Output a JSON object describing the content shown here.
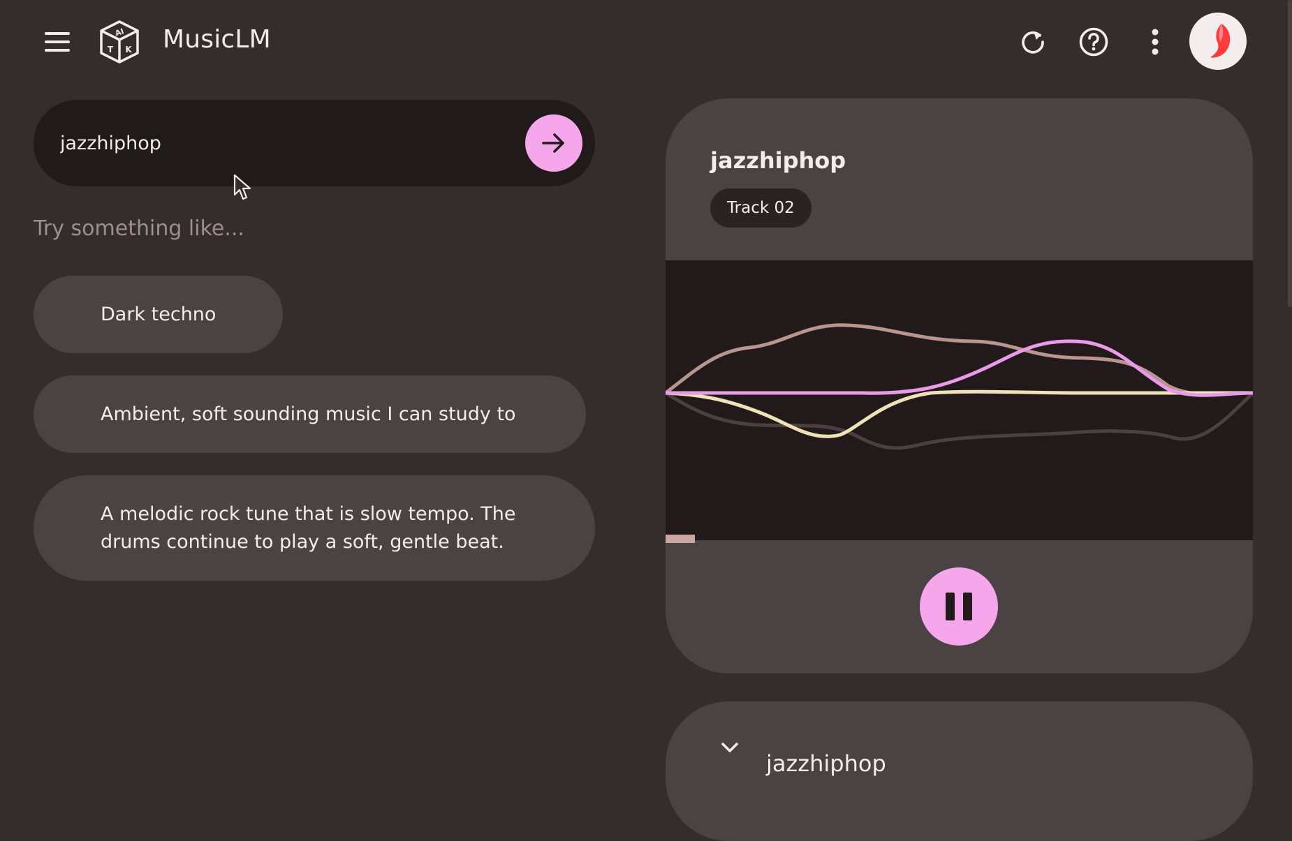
{
  "header": {
    "menu_icon": "hamburger-menu-icon",
    "logo_icon": "aitk-cube-logo",
    "logo_letters": [
      "AI",
      "T",
      "K"
    ],
    "title": "MusicLM",
    "actions": [
      {
        "name": "refresh-icon"
      },
      {
        "name": "help-icon"
      },
      {
        "name": "more-vert-icon"
      }
    ]
  },
  "search": {
    "value": "jazzhiphop",
    "submit_icon": "arrow-forward-icon"
  },
  "suggestions": {
    "label": "Try something like...",
    "items": [
      {
        "label": "Dark techno"
      },
      {
        "label": "Ambient, soft sounding music I can study to"
      },
      {
        "label": "A melodic rock tune that is slow tempo. The drums continue to play a soft, gentle beat."
      }
    ]
  },
  "player": {
    "title": "jazzhiphop",
    "track": "Track 02",
    "progress": 0.05,
    "state_icon": "pause-icon"
  },
  "collapsed_card": {
    "icon": "chevron-down-icon",
    "title": "jazzhiphop"
  },
  "colors": {
    "background": "#352c2c",
    "surface": "#4b4343",
    "input_bg": "#211a1a",
    "accent_pink": "#f6a6ea",
    "wave_pink": "#e99ae8",
    "wave_cream": "#eee2b6",
    "wave_rose": "#b9958f",
    "wave_dark": "#4a4040"
  }
}
